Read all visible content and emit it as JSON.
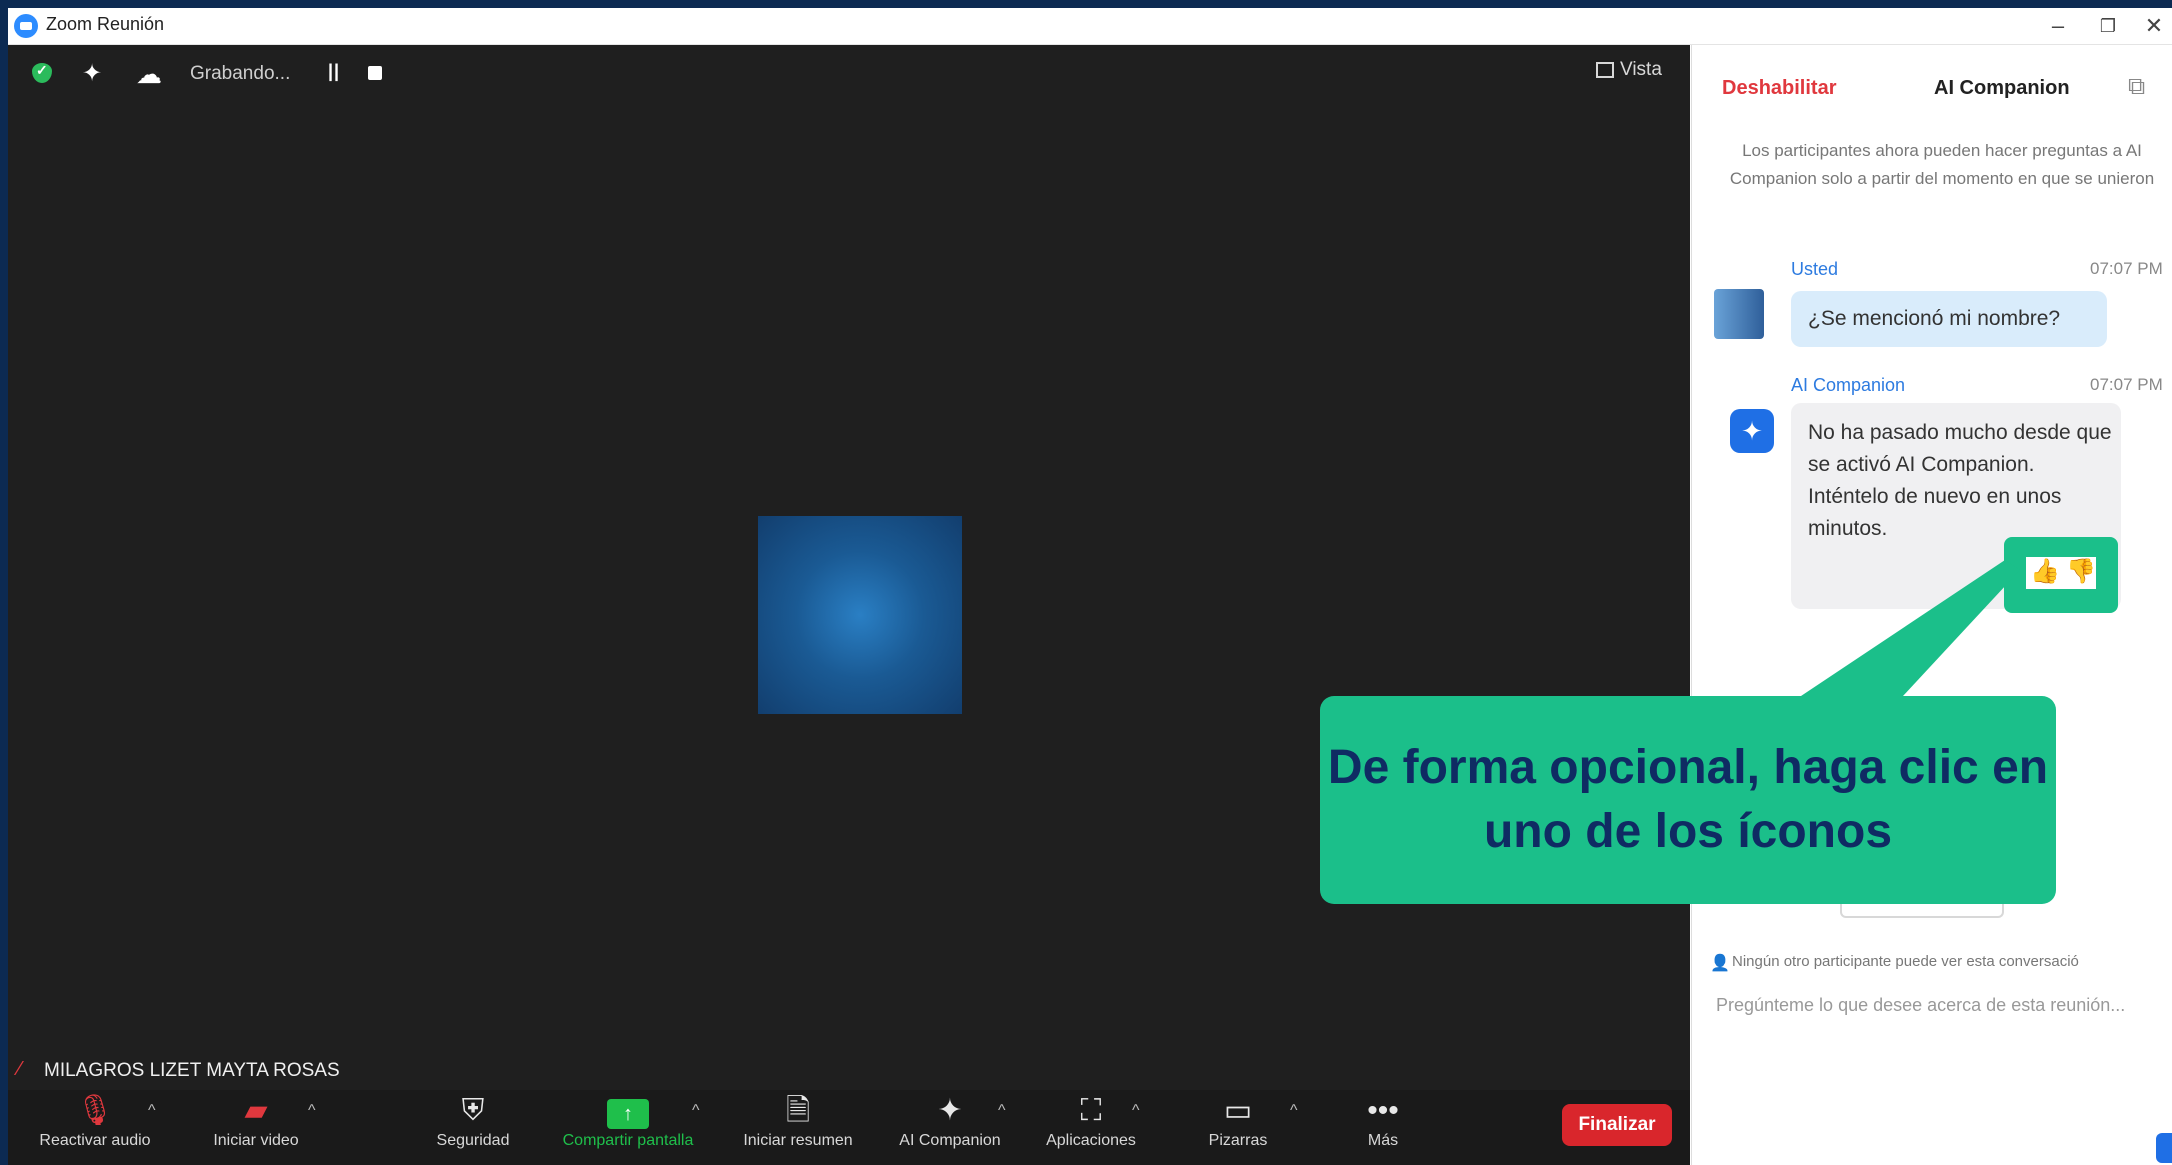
{
  "window": {
    "title": "Zoom Reunión"
  },
  "meeting": {
    "recording_status": "Grabando...",
    "view_label": "Vista",
    "participant_name": "MILAGROS LIZET MAYTA ROSAS"
  },
  "toolbar": {
    "mute": "Reactivar audio",
    "video": "Iniciar video",
    "security": "Seguridad",
    "share": "Compartir pantalla",
    "summary": "Iniciar resumen",
    "ai_companion": "AI Companion",
    "apps": "Aplicaciones",
    "whiteboards": "Pizarras",
    "more": "Más",
    "end": "Finalizar"
  },
  "panel": {
    "disable_label": "Deshabilitar",
    "title": "AI Companion",
    "notice": "Los participantes ahora pueden hacer preguntas a AI Companion solo a partir del momento en que se unieron",
    "messages": [
      {
        "sender": "Usted",
        "time": "07:07 PM",
        "text": "¿Se mencionó mi nombre?"
      },
      {
        "sender": "AI Companion",
        "time": "07:07 PM",
        "text": "No ha pasado mucho desde que se activó AI Companion. Inténtelo de nuevo en unos minutos."
      }
    ],
    "privacy_note": "Ningún otro participante puede ver esta conversació",
    "input_placeholder": "Pregúnteme lo que desee acerca de esta reunión..."
  },
  "callout": {
    "text": "De forma opcional, haga clic en uno de los íconos"
  },
  "colors": {
    "accent_green": "#1bbf8a",
    "callout_text": "#0f2b63",
    "end_red": "#d9262c",
    "zoom_blue": "#2d8cff"
  },
  "icons": [
    "shield-icon",
    "sparkle-icon",
    "cloud-icon",
    "pause-icon",
    "stop-icon",
    "grid-icon",
    "mic-off-icon",
    "video-off-icon",
    "shield-plus-icon",
    "share-screen-icon",
    "summary-doc-icon",
    "apps-icon",
    "whiteboard-icon",
    "more-icon",
    "thumbs-up-icon",
    "thumbs-down-icon",
    "popout-icon"
  ]
}
